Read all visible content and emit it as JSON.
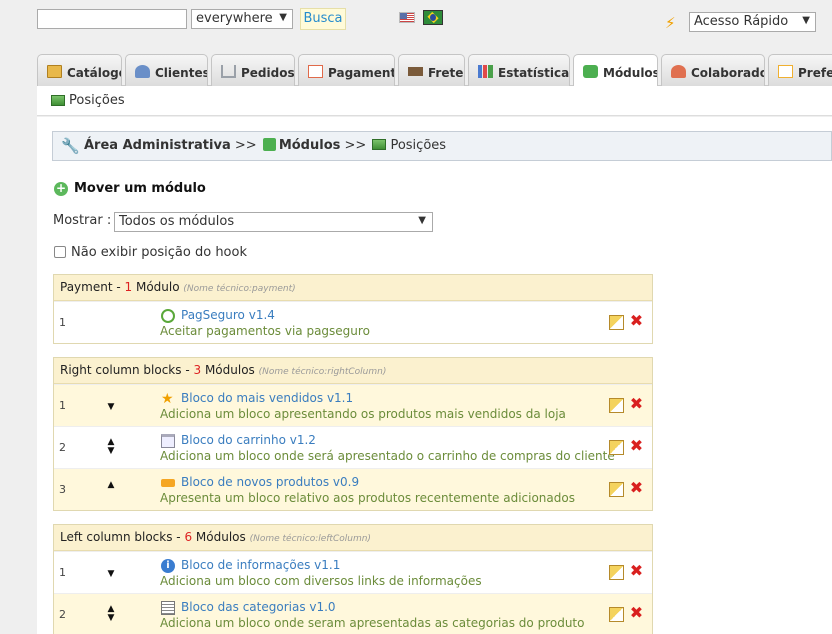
{
  "header": {
    "search_value": "",
    "scope_selected": "everywhere",
    "search_button": "Busca",
    "languages": [
      "English",
      "Português (Brasil)"
    ],
    "quick_access": "Acesso Rápido"
  },
  "tabs": [
    {
      "label": "Catálogo",
      "icon": "folder-icon",
      "color": "#e8b84a"
    },
    {
      "label": "Clientes",
      "icon": "user-icon",
      "color": "#6a8fc8"
    },
    {
      "label": "Pedidos",
      "icon": "cart-icon",
      "color": "#9aa0a8"
    },
    {
      "label": "Pagamento",
      "icon": "payment-icon",
      "color": "#e06a4a"
    },
    {
      "label": "Frete",
      "icon": "truck-icon",
      "color": "#7a5a3a"
    },
    {
      "label": "Estatísticas",
      "icon": "chart-icon",
      "color": "#4a7ad0"
    },
    {
      "label": "Módulos",
      "icon": "puzzle-icon",
      "color": "#4caf50"
    },
    {
      "label": "Colaborador",
      "icon": "person-icon",
      "color": "#e07050"
    },
    {
      "label": "Preferências",
      "icon": "settings-icon",
      "color": "#f0b030"
    }
  ],
  "subtab": {
    "label": "Posições"
  },
  "breadcrumb": {
    "root": "Área Administrativa",
    "sep": ">>",
    "section": "Módulos",
    "current": "Posições"
  },
  "move_link": "Mover um módulo",
  "filter": {
    "label": "Mostrar :",
    "selected": "Todos os módulos"
  },
  "hook_checkbox": {
    "label": "Não exibir posição do hook",
    "checked": false
  },
  "blocks": [
    {
      "title": "Payment",
      "count": "1",
      "count_suffix": "Módulo",
      "tech": "(Nome técnico:payment)",
      "rows": [
        {
          "pos": "1",
          "arrows": "",
          "icon": "pagseguro-icon",
          "name": "PagSeguro v1.4",
          "desc": "Aceitar pagamentos via pagseguro"
        }
      ]
    },
    {
      "title": "Right column blocks",
      "count": "3",
      "count_suffix": "Módulos",
      "tech": "(Nome técnico:rightColumn)",
      "rows": [
        {
          "pos": "1",
          "arrows": "down",
          "icon": "star-icon",
          "name": "Bloco do mais vendidos v1.1",
          "desc": "Adiciona um bloco apresentando os produtos mais vendidos da loja"
        },
        {
          "pos": "2",
          "arrows": "both",
          "icon": "basket-icon",
          "name": "Bloco do carrinho v1.2",
          "desc": "Adiciona um bloco onde será apresentado o carrinho de compras do cliente"
        },
        {
          "pos": "3",
          "arrows": "up",
          "icon": "new-icon",
          "name": "Bloco de novos produtos v0.9",
          "desc": "Apresenta um bloco relativo aos produtos recentemente adicionados"
        }
      ]
    },
    {
      "title": "Left column blocks",
      "count": "6",
      "count_suffix": "Módulos",
      "tech": "(Nome técnico:leftColumn)",
      "rows": [
        {
          "pos": "1",
          "arrows": "down",
          "icon": "info-icon",
          "name": "Bloco de informações v1.1",
          "desc": "Adiciona um bloco com diversos links de informações"
        },
        {
          "pos": "2",
          "arrows": "both",
          "icon": "categories-icon",
          "name": "Bloco das categorias v1.0",
          "desc": "Adiciona um bloco onde seram apresentadas as categorias do produto"
        }
      ]
    }
  ]
}
